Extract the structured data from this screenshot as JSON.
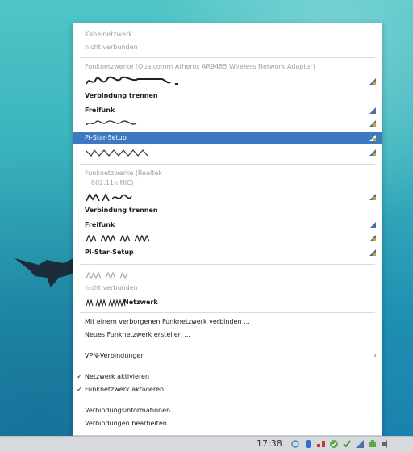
{
  "menu": {
    "wired_header": "Kabelnetzwerk",
    "wired_status": "nicht verbunden",
    "wifi1_header": "Funknetzwerke (Qualcomm Atheros AR9485 Wireless Network Adapter)",
    "wifi1_disconnect": "Verbindung trennen",
    "wifi1_freifunk": "Freifunk",
    "wifi1_pistar": "Pi-Star-Setup",
    "wifi2_header_line1": "Funknetzwerke (Realtek",
    "wifi2_header_line2": "802.11n NIC)",
    "wifi2_disconnect": "Verbindung trennen",
    "wifi2_freifunk": "Freifunk",
    "wifi2_pistar": "Pi-Star-Setup",
    "vpn_status": "nicht verbunden",
    "vpn_netzwerk_suffix": "Netzwerk",
    "connect_hidden": "Mit einem verborgenen Funknetzwerk verbinden ...",
    "create_new": "Neues Funknetzwerk erstellen ...",
    "vpn": "VPN-Verbindungen",
    "vpn_chevron": "›",
    "enable_network": "Netzwerk aktivieren",
    "enable_wifi": "Funknetzwerk aktivieren",
    "check_mark": "✓",
    "connection_info": "Verbindungsinformationen",
    "edit_connections": "Verbindungen bearbeiten ..."
  },
  "taskbar": {
    "clock": "17:38"
  },
  "colors": {
    "highlight": "#3d79c2",
    "signal_strong": "#4a6fa8",
    "lock_yellow": "#d7a21a"
  },
  "icons": [
    "wifi-lock-icon",
    "wifi-signal-icon",
    "chevron-right-icon",
    "check-icon",
    "network-tray-icon",
    "volume-icon",
    "battery-icon"
  ]
}
